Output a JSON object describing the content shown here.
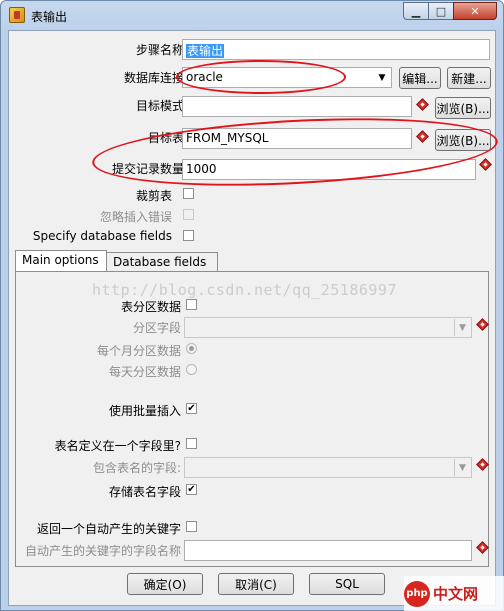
{
  "window": {
    "title": "表输出"
  },
  "form": {
    "step_name_label": "步骤名称",
    "step_name_value": "表输出",
    "connection_label": "数据库连接",
    "connection_value": "oracle",
    "edit_button": "编辑...",
    "new_button": "新建...",
    "schema_label": "目标模式",
    "schema_value": "",
    "browse_schema_button": "浏览(B)...",
    "table_label": "目标表",
    "table_value": "FROM_MYSQL",
    "browse_table_button": "浏览(B)...",
    "commit_label": "提交记录数量",
    "commit_value": "1000",
    "truncate_label": "裁剪表",
    "ignore_errors_label": "忽略插入错误",
    "specify_fields_label": "Specify database fields"
  },
  "tabs": [
    {
      "label": "Main options",
      "active": true
    },
    {
      "label": "Database fields",
      "active": false
    }
  ],
  "main_options": {
    "partition_label": "表分区数据",
    "partition_field_label": "分区字段",
    "monthly_label": "每个月分区数据",
    "daily_label": "每天分区数据",
    "batch_insert_label": "使用批量插入",
    "batch_insert_checked": "✔",
    "table_in_field_label": "表名定义在一个字段里?",
    "table_name_field_label": "包含表名的字段:",
    "store_table_name_label": "存储表名字段",
    "store_table_name_checked": "✔",
    "return_key_label": "返回一个自动产生的关键字",
    "key_field_label": "自动产生的关键字的字段名称"
  },
  "footer": {
    "ok_button": "确定(O)",
    "cancel_button": "取消(C)",
    "sql_button": "SQL"
  },
  "watermark": "http://blog.csdn.net/qq_25186997",
  "logo": {
    "text": "中文网",
    "mark": "php"
  },
  "icons": {
    "variable": "variable-diamond-icon",
    "dropdown": "chevron-down-icon",
    "app": "table-output-icon"
  },
  "colors": {
    "annotation": "#e2141b",
    "selection": "#3399ff",
    "variable_icon": "#d9312b"
  }
}
